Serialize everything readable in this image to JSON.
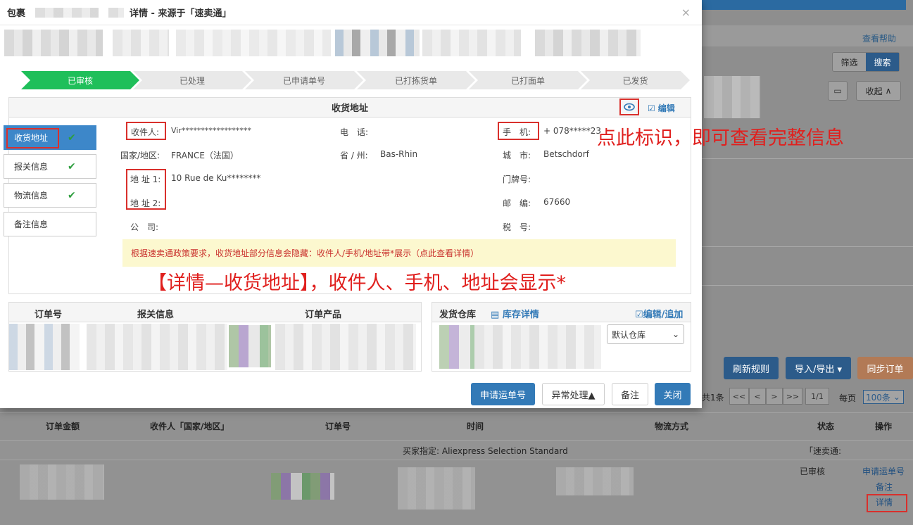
{
  "modal": {
    "title_prefix": "包裹",
    "title_suffix": "详情 - 来源于「速卖通」",
    "close": "×"
  },
  "steps": [
    "已审核",
    "已处理",
    "已申请单号",
    "已打拣货单",
    "已打面单",
    "已发货"
  ],
  "address_panel": {
    "title": "收货地址",
    "edit": "编辑",
    "fields": {
      "recipient_label": "收件人:",
      "recipient": "Vir******************",
      "phone_label": "电　话:",
      "phone": "",
      "mobile_label": "手　机:",
      "mobile": "+ 078*****23",
      "country_label": "国家/地区:",
      "country": "FRANCE（法国）",
      "province_label": "省 / 州:",
      "province": "Bas-Rhin",
      "city_label": "城　市:",
      "city": "Betschdorf",
      "addr1_label": "地 址 1:",
      "addr1": "10 Rue de Ku********",
      "door_label": "门牌号:",
      "door": "",
      "addr2_label": "地 址 2:",
      "addr2": "",
      "zip_label": "邮　编:",
      "zip": "67660",
      "company_label": "公　司:",
      "company": "",
      "tax_label": "税　号:",
      "tax": ""
    },
    "notice": "根据速卖通政策要求，收货地址部分信息会隐藏：收件人/手机/地址带*展示（点此查看详情）"
  },
  "side_tabs": [
    {
      "label": "收货地址",
      "checked": true
    },
    {
      "label": "报关信息",
      "checked": true
    },
    {
      "label": "物流信息",
      "checked": true
    },
    {
      "label": "备注信息",
      "checked": false
    }
  ],
  "annotations": {
    "eye_hint": "点此标识，即可查看完整信息",
    "main_hint": "【详情—收货地址】，收件人、手机、地址会显示*"
  },
  "order_table": {
    "headers": [
      "订单号",
      "报关信息",
      "订单产品"
    ]
  },
  "warehouse": {
    "title": "发货仓库",
    "stock_link": "库存详情",
    "edit_link": "编辑/追加",
    "select": "默认仓库"
  },
  "footer_buttons": {
    "apply": "申请运单号",
    "exception": "异常处理▲",
    "note": "备注",
    "close": "关闭"
  },
  "background": {
    "help": "查看帮助",
    "filter": "筛选",
    "search": "搜索",
    "collapse": "收起",
    "refresh_rules": "刷新规则",
    "import_export": "导入/导出 ▾",
    "sync_orders": "同步订单",
    "total": "共1条",
    "pager": [
      "<<",
      "<",
      ">",
      ">>"
    ],
    "page": "1/1",
    "per_page_label": "每页",
    "per_page": "100条",
    "columns": [
      "订单金额",
      "收件人「国家/地区」",
      "订单号",
      "时间",
      "物流方式",
      "状态",
      "操作"
    ],
    "buyer_specified": "买家指定:   Aliexpress Selection Standard",
    "source_tag": "「速卖通:",
    "status": "已审核",
    "actions": [
      "申请运单号",
      "备注",
      "详情"
    ]
  },
  "colors": {
    "accent": "#337ab7",
    "step_active": "#1fbf5a",
    "step_inactive": "#e9e9e9",
    "red": "#d9302c",
    "sync": "#e8a57a"
  }
}
